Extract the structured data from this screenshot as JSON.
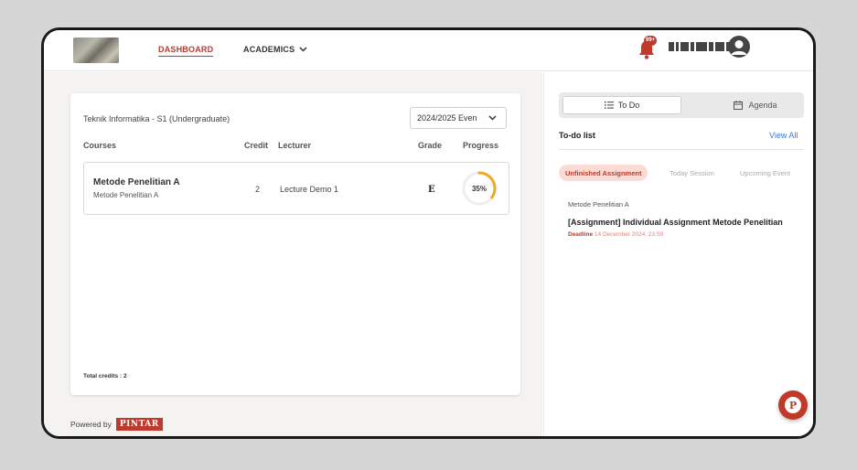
{
  "header": {
    "nav": {
      "dashboard": "DASHBOARD",
      "academics": "ACADEMICS"
    },
    "notification_count": "99+",
    "icons": {
      "logo": "campus-photo-logo",
      "bell": "bell-icon",
      "avatar": "user-avatar-icon",
      "chevron": "chevron-down-icon"
    }
  },
  "main": {
    "program": "Teknik Informatika - S1 (Undergraduate)",
    "semester": "2024/2025 Even",
    "columns": {
      "courses": "Courses",
      "credit": "Credit",
      "lecturer": "Lecturer",
      "grade": "Grade",
      "progress": "Progress"
    },
    "courses": [
      {
        "title": "Metode Penelitian A",
        "subtitle": "Metode Penelitian A",
        "credit": "2",
        "lecturer": "Lecture Demo 1",
        "grade": "E",
        "progress_label": "35%",
        "progress": 0.35
      }
    ],
    "total_credits": "Total credits : 2",
    "powered_by": "Powered by",
    "brand": "PINTAR"
  },
  "todo": {
    "tabs": {
      "todo": "To Do",
      "agenda": "Agenda"
    },
    "title": "To-do list",
    "view_all": "View All",
    "filters": {
      "unfinished": "Unfinished Assignment",
      "today": "Today Session",
      "upcoming": "Upcoming Event"
    },
    "item": {
      "course": "Metode Penelitian A",
      "title": "[Assignment] Individual Assignment Metode Penelitian",
      "deadline_label": "Deadline",
      "deadline": "14 December 2024, 23:59"
    },
    "fab_letter": "P"
  },
  "colors": {
    "accent": "#c0392b",
    "progress": "#f5a623",
    "link": "#3a7bd5"
  }
}
